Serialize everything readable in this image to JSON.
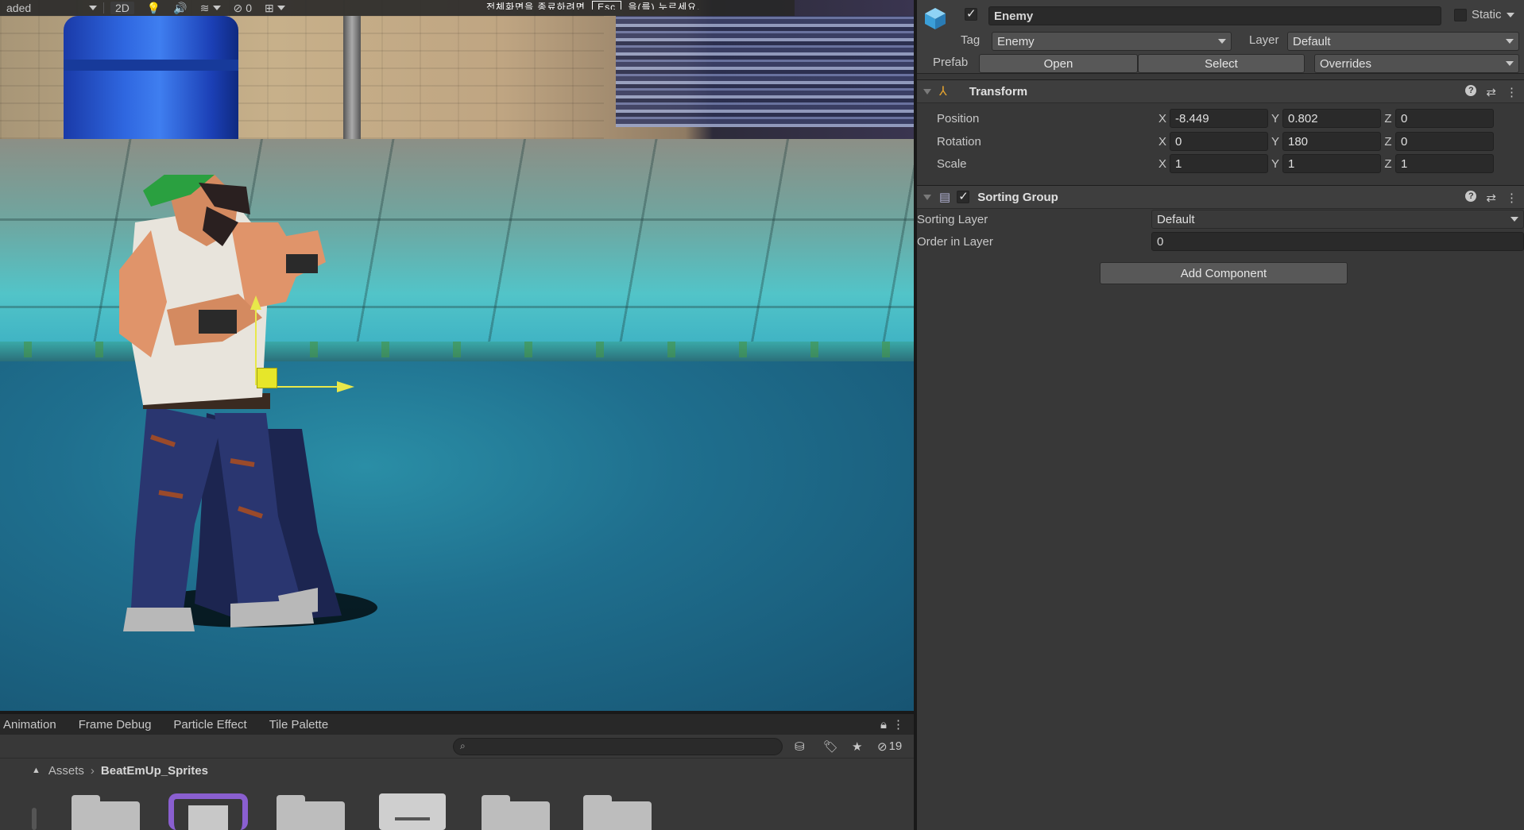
{
  "scene_toolbar": {
    "shading_mode": "aded",
    "mode_2d": "2D",
    "hidden_count": "0"
  },
  "overlay": {
    "text_before": "전체화면을 종료하려면",
    "key": "Esc",
    "text_after": "을(를) 누르세요."
  },
  "inspector": {
    "object_name": "Enemy",
    "static_label": "Static",
    "tag_label": "Tag",
    "tag_value": "Enemy",
    "layer_label": "Layer",
    "layer_value": "Default",
    "prefab_label": "Prefab",
    "prefab_open": "Open",
    "prefab_select": "Select",
    "prefab_overrides": "Overrides",
    "transform": {
      "title": "Transform",
      "position": {
        "label": "Position",
        "x": "-8.449",
        "y": "0.802",
        "z": "0"
      },
      "rotation": {
        "label": "Rotation",
        "x": "0",
        "y": "180",
        "z": "0"
      },
      "scale": {
        "label": "Scale",
        "x": "1",
        "y": "1",
        "z": "1"
      }
    },
    "sorting_group": {
      "title": "Sorting Group",
      "sorting_layer_label": "Sorting Layer",
      "sorting_layer_value": "Default",
      "order_label": "Order in Layer",
      "order_value": "0"
    },
    "add_component": "Add Component",
    "axis": {
      "x": "X",
      "y": "Y",
      "z": "Z"
    }
  },
  "bottom_panel": {
    "tabs": [
      "Animation",
      "Frame Debug",
      "Particle Effect",
      "Tile Palette"
    ],
    "hidden_count": "19",
    "breadcrumb": {
      "root": "Assets",
      "current": "BeatEmUp_Sprites"
    }
  },
  "colors": {
    "gizmo_yellow": "#e6e62a",
    "panel_bg": "#383838",
    "field_bg": "#2a2a2a"
  }
}
